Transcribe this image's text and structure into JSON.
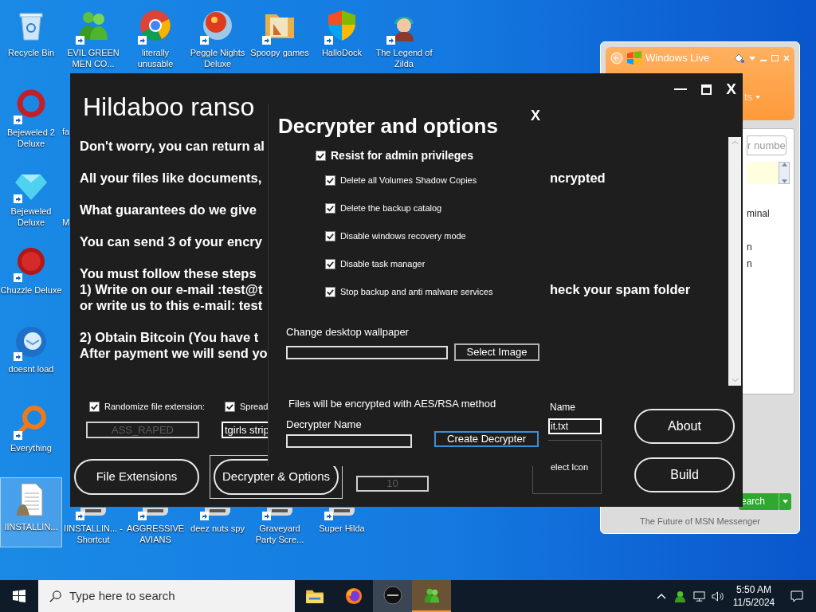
{
  "desktop_icons": [
    {
      "label": "Recycle Bin",
      "shortcut": false,
      "selected": false
    },
    {
      "label": "EVIL GREEN MEN CO...",
      "shortcut": true,
      "selected": false
    },
    {
      "label": "literally unusable",
      "shortcut": true,
      "selected": false
    },
    {
      "label": "Peggle Nights Deluxe",
      "shortcut": true,
      "selected": false
    },
    {
      "label": "Spoopy games",
      "shortcut": true,
      "selected": false
    },
    {
      "label": "HalloDock",
      "shortcut": true,
      "selected": false
    },
    {
      "label": "The Legend of Zilda",
      "shortcut": true,
      "selected": false
    },
    {
      "label": "Bejeweled 2 Deluxe",
      "shortcut": true,
      "selected": false
    },
    {
      "label": "Bejeweled Deluxe",
      "shortcut": true,
      "selected": false
    },
    {
      "label": "Chuzzle Deluxe",
      "shortcut": true,
      "selected": false
    },
    {
      "label": "doesnt load",
      "shortcut": true,
      "selected": false
    },
    {
      "label": "Everything",
      "shortcut": true,
      "selected": false
    },
    {
      "label": "IINSTALLIN...",
      "shortcut": false,
      "selected": true
    },
    {
      "label": "IINSTALLIN... - Shortcut",
      "shortcut": true,
      "selected": false
    },
    {
      "label": "AGGRESSIVE AVIANS",
      "shortcut": true,
      "selected": false
    },
    {
      "label": "deez nuts spy",
      "shortcut": true,
      "selected": false
    },
    {
      "label": "Graveyard Party Scre...",
      "shortcut": true,
      "selected": false
    },
    {
      "label": "Super Hilda",
      "shortcut": true,
      "selected": false
    }
  ],
  "covered_icon_labels": [
    "fa",
    "M"
  ],
  "msn_window": {
    "title": "Windows Live",
    "menu_fragment": "ts",
    "search_placeholder_fragment": "r numbe",
    "list_fragments": [
      "minal",
      "n",
      "n"
    ],
    "search_button_fragment": "earch",
    "footer": "The Future of MSN Messenger"
  },
  "builder_window": {
    "title": "Hildaboo ranso",
    "close": "X",
    "message": [
      [
        {
          "text": "Don't worry, you can return al"
        }
      ],
      [
        {
          "text": "All your files like documents, ",
          "text_after_dialog": "ncrypted"
        }
      ],
      [
        {
          "text": "What guarantees do we give "
        }
      ],
      [
        {
          "text": "You can send 3 of your encry"
        }
      ],
      [
        {
          "text": "You must follow these steps "
        },
        {
          "text": "1) Write on our e-mail :test@t",
          "text_after_dialog": "heck your spam folder"
        },
        {
          "text": "or write us to this e-mail: test"
        }
      ],
      [
        {
          "text": "2) Obtain Bitcoin (You have t"
        },
        {
          "text": "After payment we will send yo"
        }
      ]
    ],
    "options": [
      {
        "label": "Randomize file extension:",
        "checked": true,
        "value": "ASS_RAPED",
        "disabled": true
      },
      {
        "label": "Spread",
        "checked": true,
        "value": "tgirls strip",
        "disabled": false
      }
    ],
    "buttons": [
      {
        "label": "File Extensions",
        "focused": false
      },
      {
        "label": "Decrypter & Options",
        "focused": true
      }
    ],
    "count_field": {
      "value": "10",
      "disabled": true
    },
    "name_label": "Name",
    "name_value": "it.txt",
    "icon_picker_label": "elect Icon",
    "side_buttons": [
      "About",
      "Build"
    ]
  },
  "dialog": {
    "title": "Decrypter and options",
    "close": "X",
    "main_option": {
      "label": "Resist for admin privileges",
      "checked": true
    },
    "options": [
      {
        "label": "Delete all Volumes Shadow Copies",
        "checked": true
      },
      {
        "label": "Delete the backup catalog",
        "checked": true
      },
      {
        "label": "Disable windows recovery mode",
        "checked": true
      },
      {
        "label": "Disable task manager",
        "checked": true
      },
      {
        "label": "Stop backup and anti malware services",
        "checked": true
      }
    ],
    "wallpaper_label": "Change desktop wallpaper",
    "wallpaper_button": "Select Image",
    "note": "Files will be encrypted with AES/RSA method",
    "name_label": "Decrypter Name",
    "create_button": "Create Decrypter"
  },
  "taskbar": {
    "search_placeholder": "Type here to search",
    "apps": [
      {
        "open": false,
        "active": false
      },
      {
        "open": false,
        "active": false
      },
      {
        "open": true,
        "active": false
      },
      {
        "open": true,
        "active": true
      }
    ],
    "time": "5:50 AM",
    "date": "11/5/2024"
  }
}
